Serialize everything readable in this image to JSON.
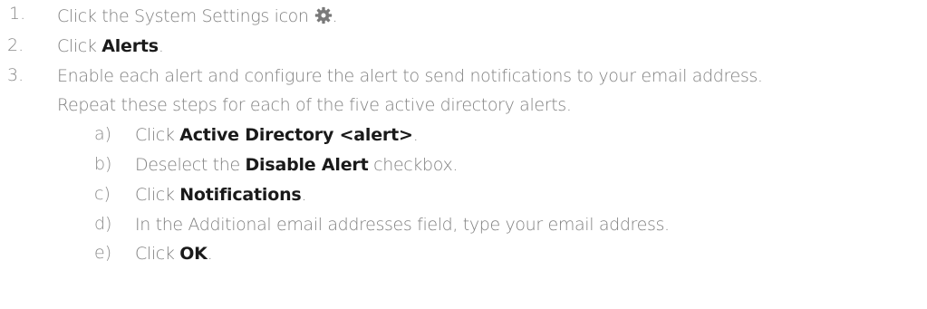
{
  "steps": [
    {
      "number": "1.",
      "text_before": "Click the System Settings icon",
      "icon": "gear-icon",
      "text_after": "."
    },
    {
      "number": "2.",
      "prefix": "Click ",
      "bold": "Alerts",
      "suffix": "."
    },
    {
      "number": "3.",
      "line1": "Enable each alert and configure the alert to send notifications to your email address.",
      "line2": "Repeat these steps for each of the five active directory alerts."
    }
  ],
  "substeps": [
    {
      "letter": "a)",
      "prefix": "Click ",
      "bold": "Active Directory <alert>",
      "suffix": "."
    },
    {
      "letter": "b)",
      "prefix": "Deselect the ",
      "bold": "Disable Alert",
      "suffix": " checkbox."
    },
    {
      "letter": "c)",
      "prefix": "Click ",
      "bold": "Notifications",
      "suffix": "."
    },
    {
      "letter": "d)",
      "text": "In the Additional email addresses field, type your email address."
    },
    {
      "letter": "e)",
      "prefix": "Click ",
      "bold": "OK",
      "suffix": "."
    }
  ],
  "colors": {
    "body_text": "#808080",
    "bold_text": "#1a1a1a",
    "icon": "#7a7a7a"
  }
}
